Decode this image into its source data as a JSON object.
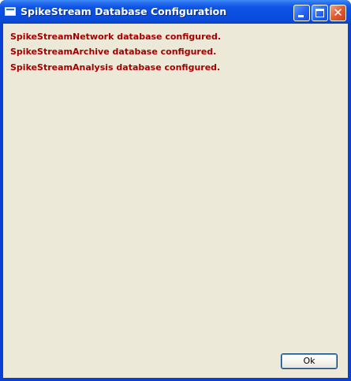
{
  "window": {
    "title": "SpikeStream Database Configuration"
  },
  "messages": [
    "SpikeStreamNetwork database configured.",
    "SpikeStreamArchive database configured.",
    "SpikeStreamAnalysis database configured."
  ],
  "buttons": {
    "ok_label": "Ok",
    "close_glyph": "✕"
  },
  "colors": {
    "message_text": "#a40000",
    "dialog_background": "#ece9d8",
    "titlebar": "#0a4ee0"
  }
}
